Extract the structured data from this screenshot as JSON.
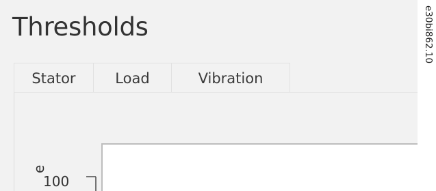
{
  "page": {
    "title": "Thresholds"
  },
  "tabs": [
    {
      "label": "Stator"
    },
    {
      "label": "Load"
    },
    {
      "label": "Vibration"
    }
  ],
  "chart": {
    "y_axis_label_fragment": "e",
    "y_tick_label": "100"
  },
  "figure": {
    "code": "e30bi862.10"
  }
}
